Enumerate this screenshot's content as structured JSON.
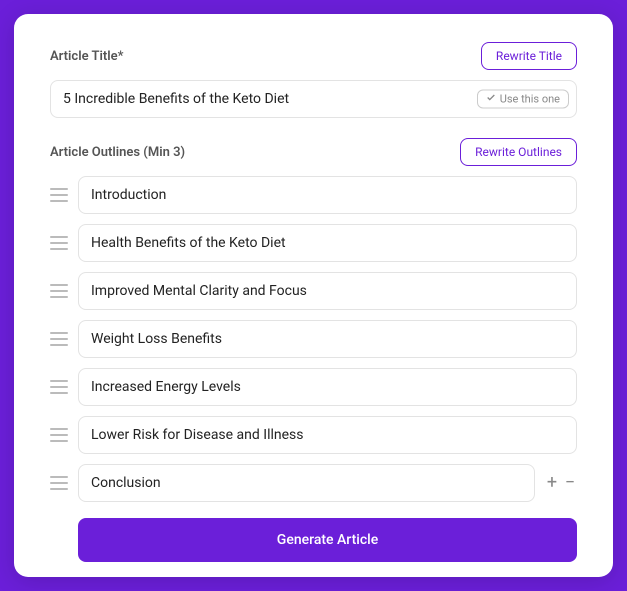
{
  "colors": {
    "accent": "#6b1fd9"
  },
  "title_section": {
    "label": "Article Title*",
    "rewrite_btn": "Rewrite Title",
    "input_value": "5 Incredible Benefits of the Keto Diet",
    "use_badge": "Use this one"
  },
  "outlines_section": {
    "label": "Article Outlines (Min 3)",
    "rewrite_btn": "Rewrite Outlines",
    "items": [
      {
        "value": "Introduction"
      },
      {
        "value": "Health Benefits of the Keto Diet"
      },
      {
        "value": "Improved Mental Clarity and Focus"
      },
      {
        "value": "Weight Loss Benefits"
      },
      {
        "value": "Increased Energy Levels"
      },
      {
        "value": "Lower Risk for Disease and Illness"
      },
      {
        "value": "Conclusion",
        "show_controls": true
      }
    ]
  },
  "generate_btn": "Generate Article"
}
